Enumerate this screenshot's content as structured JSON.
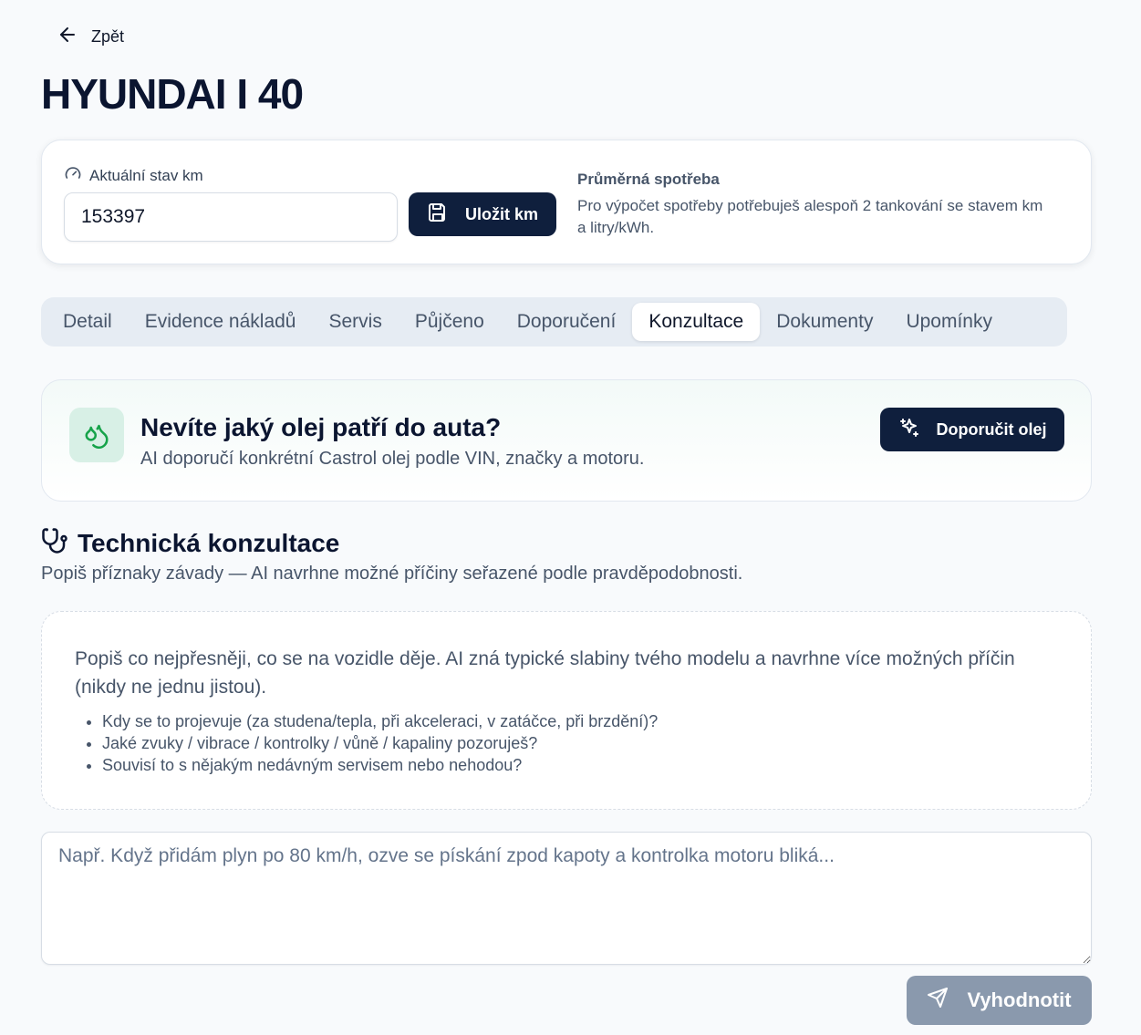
{
  "nav": {
    "back_label": "Zpět"
  },
  "vehicle": {
    "title": "HYUNDAI I 40"
  },
  "km_card": {
    "label": "Aktuální stav km",
    "value": "153397",
    "save_label": "Uložit km",
    "consumption_title": "Průměrná spotřeba",
    "consumption_text": "Pro výpočet spotřeby potřebuješ alespoň 2 tankování se stavem km a litry/kWh."
  },
  "tabs": [
    {
      "label": "Detail",
      "active": false
    },
    {
      "label": "Evidence nákladů",
      "active": false
    },
    {
      "label": "Servis",
      "active": false
    },
    {
      "label": "Půjčeno",
      "active": false
    },
    {
      "label": "Doporučení",
      "active": false
    },
    {
      "label": "Konzultace",
      "active": true
    },
    {
      "label": "Dokumenty",
      "active": false
    },
    {
      "label": "Upomínky",
      "active": false
    }
  ],
  "oil_card": {
    "title": "Nevíte jaký olej patří do auta?",
    "subtitle": "AI doporučí konkrétní Castrol olej podle VIN, značky a motoru.",
    "button_label": "Doporučit olej"
  },
  "consultation": {
    "title": "Technická konzultace",
    "subtitle": "Popiš příznaky závady — AI navrhne možné příčiny seřazené podle pravděpodobnosti.",
    "hint_text": "Popiš co nejpřesněji, co se na vozidle děje. AI zná typické slabiny tvého modelu a navrhne více možných příčin (nikdy ne jednu jistou).",
    "hints": [
      "Kdy se to projevuje (za studena/tepla, při akceleraci, v zatáčce, při brzdění)?",
      "Jaké zvuky / vibrace / kontrolky / vůně / kapaliny pozoruješ?",
      "Souvisí to s nějakým nedávným servisem nebo nehodou?"
    ],
    "input_placeholder": "Např. Když přidám plyn po 80 km/h, ozve se pískání zpod kapoty a kontrolka motoru bliká...",
    "submit_label": "Vyhodnotit"
  },
  "colors": {
    "primary": "#0f1f3d",
    "disabled_button": "#8a99ad",
    "accent_green": "#16a34a",
    "oil_icon_bg": "#d8f0e6"
  }
}
